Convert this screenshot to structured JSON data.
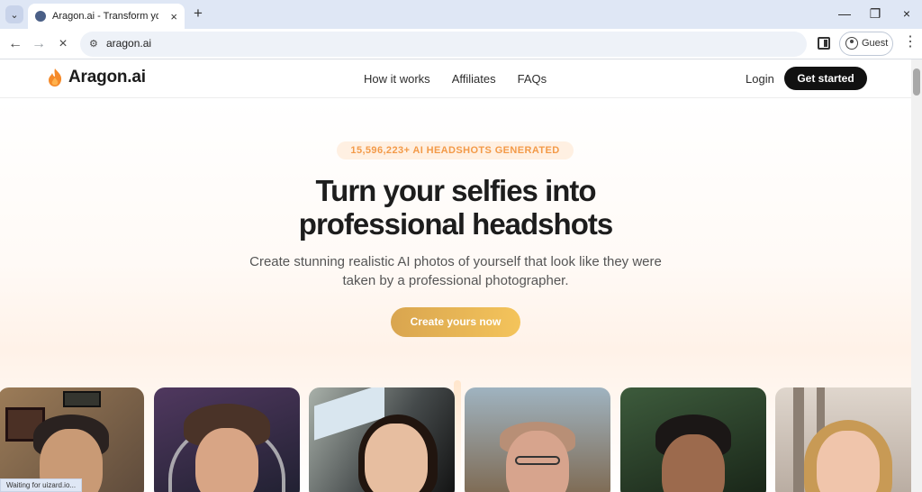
{
  "browser": {
    "tab_title": "Aragon.ai - Transform your selfie",
    "url": "aragon.ai",
    "profile_label": "Guest",
    "status_text": "Waiting for uizard.io..."
  },
  "site": {
    "brand": "Aragon.ai",
    "nav": [
      "How it works",
      "Affiliates",
      "FAQs"
    ],
    "login": "Login",
    "get_started": "Get started"
  },
  "hero": {
    "badge": "15,596,223+ AI HEADSHOTS GENERATED",
    "headline_line1": "Turn your selfies into",
    "headline_line2": "professional headshots",
    "subtext_line1": "Create stunning realistic AI photos of yourself that look like they were",
    "subtext_line2": "taken by a professional photographer.",
    "cta": "Create yours now"
  },
  "colors": {
    "accent": "#f39a48",
    "cta": "#e3b150",
    "dark": "#111111"
  }
}
